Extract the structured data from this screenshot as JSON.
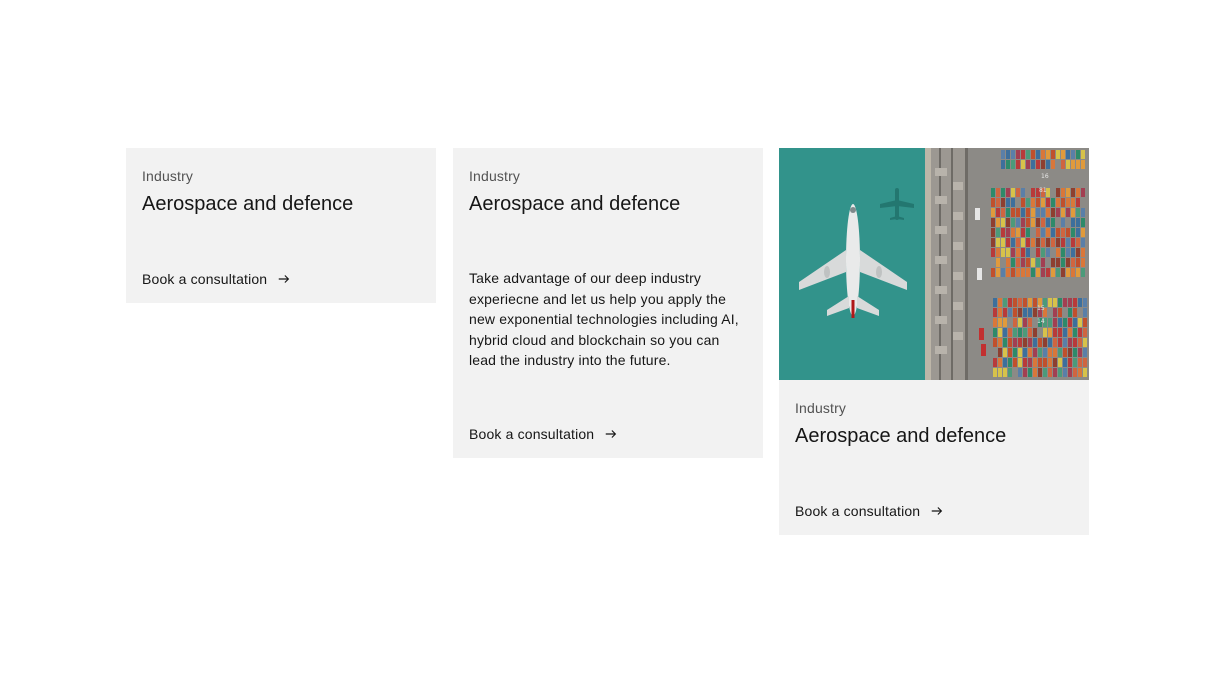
{
  "cards": [
    {
      "eyebrow": "Industry",
      "title": "Aerospace and defence",
      "cta": "Book a consultation"
    },
    {
      "eyebrow": "Industry",
      "title": "Aerospace and defence",
      "description": "Take advantage of our deep industry experiecne and let us help you apply the new exponential technologies including AI, hybrid cloud and blockchain so you can lead the industry into the future.",
      "cta": "Book a consultation"
    },
    {
      "eyebrow": "Industry",
      "title": "Aerospace and defence",
      "cta": "Book a consultation",
      "image_alt": "aerial-view-airplane-over-container-port"
    }
  ],
  "icons": {
    "cta_arrow": "arrow-right-icon"
  },
  "colors": {
    "card_background": "#f2f2f2",
    "text_primary": "#161616",
    "text_secondary": "#525252",
    "sea": "#2f8f87"
  }
}
